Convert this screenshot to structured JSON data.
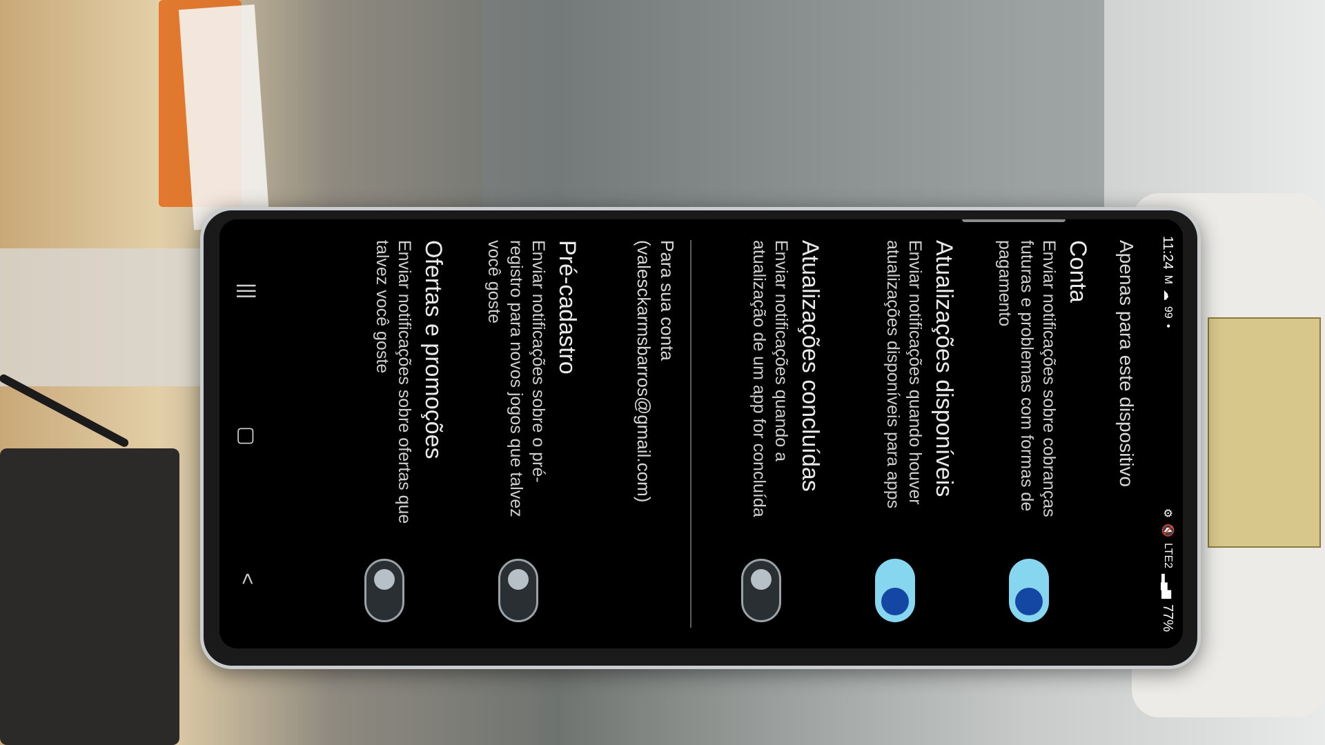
{
  "status_bar": {
    "time": "11:24",
    "left_icons": [
      "M",
      "☁",
      "99",
      "•"
    ],
    "battery": "77%",
    "right_icons": [
      "⚙",
      "🔇",
      "LTE2",
      "▂▄▆"
    ]
  },
  "section_header": "Apenas para este dispositivo",
  "settings": [
    {
      "title": "Conta",
      "description": "Enviar notificações sobre cobranças futuras e problemas com formas de pagamento",
      "enabled": true
    },
    {
      "title": "Atualizações disponíveis",
      "description": "Enviar notificações quando houver atualizações disponíveis para apps",
      "enabled": true
    },
    {
      "title": "Atualizações concluídas",
      "description": "Enviar notificações quando a atualização de um app for concluída",
      "enabled": false
    }
  ],
  "account_section": {
    "title": "Para sua conta",
    "email": "(valesckarmsbarros@gmail.com)"
  },
  "account_settings": [
    {
      "title": "Pré-cadastro",
      "description": "Enviar notificações sobre o pré-registro para novos jogos que talvez você goste",
      "enabled": false
    },
    {
      "title": "Ofertas e promoções",
      "description": "Enviar notificações sobre ofertas que talvez você goste",
      "enabled": false
    }
  ],
  "nav": {
    "recents": "|||",
    "home": "▢",
    "back": "<"
  }
}
